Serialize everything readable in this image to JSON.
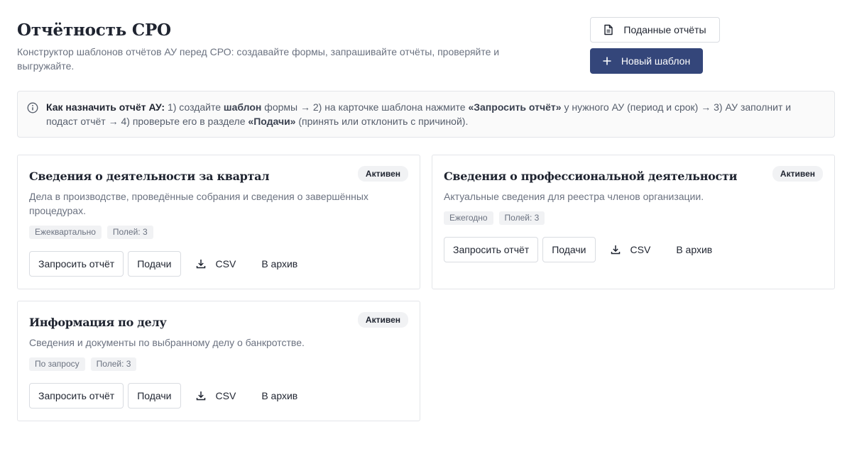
{
  "header": {
    "title": "Отчётность СРО",
    "subtitle": "Конструктор шаблонов отчётов АУ перед СРО: создавайте формы, запрашивайте отчёты, проверяйте и выгружайте.",
    "submitted_reports_label": "Поданные отчёты",
    "new_template_label": "Новый шаблон"
  },
  "info": {
    "lead": "Как назначить отчёт АУ:",
    "p1": " 1) создайте ",
    "k1": "шаблон",
    "p2": " формы → 2) на карточке шаблона нажмите ",
    "k2": "«Запросить отчёт»",
    "p3": " у нужного АУ (период и срок) → 3) АУ заполнит и подаст отчёт → 4) проверьте его в разделе ",
    "k3": "«Подачи»",
    "p4": " (принять или отклонить с причиной)."
  },
  "cards": [
    {
      "title": "Сведения о деятельности за квартал",
      "status": "Активен",
      "description": "Дела в производстве, проведённые собрания и сведения о завершённых процедурах.",
      "tags": [
        "Ежеквартально",
        "Полей: 3"
      ],
      "actions": {
        "request": "Запросить отчёт",
        "submissions": "Подачи",
        "csv": "CSV",
        "archive": "В архив"
      }
    },
    {
      "title": "Сведения о профессиональной деятельности",
      "status": "Активен",
      "description": "Актуальные сведения для реестра членов организации.",
      "tags": [
        "Ежегодно",
        "Полей: 3"
      ],
      "actions": {
        "request": "Запросить отчёт",
        "submissions": "Подачи",
        "csv": "CSV",
        "archive": "В архив"
      }
    },
    {
      "title": "Информация по делу",
      "status": "Активен",
      "description": "Сведения и документы по выбранному делу о банкротстве.",
      "tags": [
        "По запросу",
        "Полей: 3"
      ],
      "actions": {
        "request": "Запросить отчёт",
        "submissions": "Подачи",
        "csv": "CSV",
        "archive": "В архив"
      }
    }
  ],
  "icons": {
    "document": "document-icon",
    "plus": "plus-icon",
    "info": "info-icon",
    "download": "download-icon"
  },
  "colors": {
    "primary": "#34467a",
    "border": "#e3e5e9",
    "muted_text": "#6b7280",
    "badge_bg": "#f1f2f4"
  }
}
